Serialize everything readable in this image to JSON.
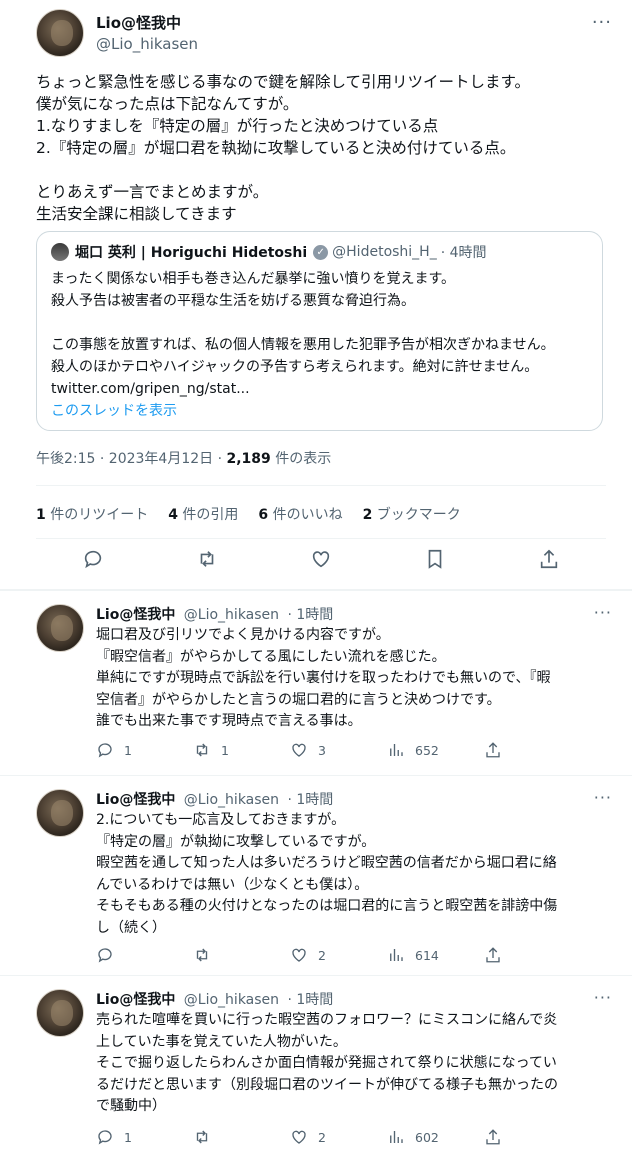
{
  "main": {
    "author_name": "Lio@怪我中",
    "author_handle": "@Lio_hikasen",
    "text_lines": [
      "ちょっと緊急性を感じる事なので鍵を解除して引用リツイートします。",
      "僕が気になった点は下記なんてすが。",
      "1.なりすましを『特定の層』が行ったと決めつけている点",
      "2.『特定の層』が堀口君を執拗に攻撃していると決め付けている点。",
      "",
      "とりあえず一言でまとめますが。",
      "生活安全課に相談してきます"
    ],
    "quote": {
      "name": "堀口 英利 | Horiguchi Hidetoshi",
      "handle": "@Hidetoshi_H_",
      "time": "· 4時間",
      "lines": [
        "まったく関係ない相手も巻き込んだ暴挙に強い憤りを覚えます。",
        "殺人予告は被害者の平穏な生活を妨げる悪質な脅迫行為。",
        "",
        "この事態を放置すれば、私の個人情報を悪用した犯罪予告が相次ぎかねません。",
        "殺人のほかテロやハイジャックの予告すら考えられます。絶対に許せません。",
        "twitter.com/gripen_ng/stat..."
      ],
      "thread_link": "このスレッドを表示"
    },
    "meta_time": "午後2:15 · 2023年4月12日 · ",
    "meta_views_count": "2,189",
    "meta_views_label": " 件の表示",
    "stats": [
      {
        "count": "1",
        "label": " 件のリツイート"
      },
      {
        "count": "4",
        "label": " 件の引用"
      },
      {
        "count": "6",
        "label": " 件のいいね"
      },
      {
        "count": "2",
        "label": " ブックマーク"
      }
    ]
  },
  "replies": [
    {
      "name": "Lio@怪我中",
      "handle": "@Lio_hikasen",
      "time": "· 1時間",
      "lines": [
        "堀口君及び引リツでよく見かける内容ですが。",
        "『暇空信者』がやらかしてる風にしたい流れを感じた。",
        "単純にですが現時点で訴訟を行い裏付けを取ったわけでも無いので、『暇",
        "空信者』がやらかしたと言うの堀口君的に言うと決めつけです。",
        "誰でも出来た事です現時点で言える事は。"
      ],
      "reply_count": "1",
      "retweet_count": "1",
      "like_count": "3",
      "view_count": "652"
    },
    {
      "name": "Lio@怪我中",
      "handle": "@Lio_hikasen",
      "time": "· 1時間",
      "lines": [
        "2.についても一応言及しておきますが。",
        "『特定の層』が執拗に攻撃しているですが。",
        "暇空茜を通して知った人は多いだろうけど暇空茜の信者だから堀口君に絡",
        "んでいるわけでは無い（少なくとも僕は）。",
        "そもそもある種の火付けとなったのは堀口君的に言うと暇空茜を誹謗中傷",
        "し（続く）"
      ],
      "reply_count": "",
      "retweet_count": "",
      "like_count": "2",
      "view_count": "614"
    },
    {
      "name": "Lio@怪我中",
      "handle": "@Lio_hikasen",
      "time": "· 1時間",
      "lines": [
        "売られた喧嘩を買いに行った暇空茜のフォロワー？にミスコンに絡んで炎",
        "上していた事を覚えていた人物がいた。",
        "そこで掘り返したらわんさか面白情報が発掘されて祭りに状態になってい",
        "るだけだと思います（別段堀口君のツイートが伸びてる様子も無かったの",
        "で騒動中）"
      ],
      "reply_count": "1",
      "retweet_count": "",
      "like_count": "2",
      "view_count": "602"
    }
  ]
}
